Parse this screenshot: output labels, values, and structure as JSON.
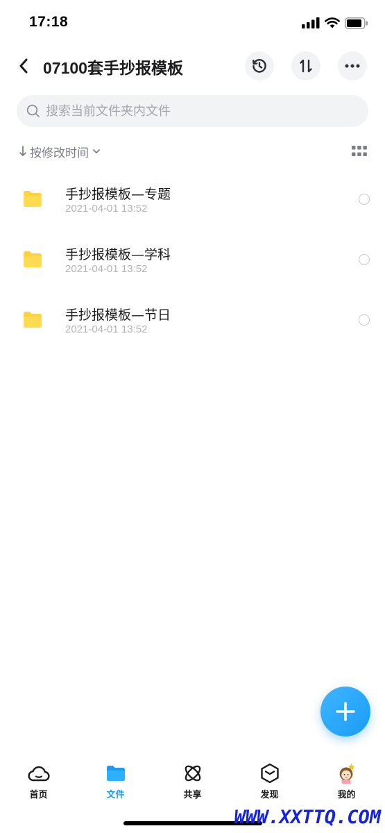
{
  "status_bar": {
    "time": "17:18"
  },
  "header": {
    "title": "07100套手抄报模板",
    "back_icon": "chevron-left-icon",
    "actions": [
      "history-icon",
      "transfer-sort-icon",
      "more-icon"
    ]
  },
  "search": {
    "placeholder": "搜索当前文件夹内文件",
    "value": ""
  },
  "sort": {
    "label": "按修改时间"
  },
  "files": [
    {
      "name": "手抄报模板—专题",
      "date": "2021-04-01 13:52"
    },
    {
      "name": "手抄报模板—学科",
      "date": "2021-04-01 13:52"
    },
    {
      "name": "手抄报模板—节日",
      "date": "2021-04-01 13:52"
    }
  ],
  "tabs": [
    {
      "label": "首页",
      "icon": "cloud-icon"
    },
    {
      "label": "文件",
      "icon": "folder-icon"
    },
    {
      "label": "共享",
      "icon": "atom-icon"
    },
    {
      "label": "发现",
      "icon": "cube-icon"
    },
    {
      "label": "我的",
      "icon": "avatar"
    }
  ],
  "active_tab": "文件",
  "watermark": "WWW.XXTTQ.COM",
  "colors": {
    "accent": "#1a9cf5",
    "folder": "#ffd23f",
    "text_primary": "#1c1c1e",
    "text_secondary": "#b2b4ba"
  }
}
